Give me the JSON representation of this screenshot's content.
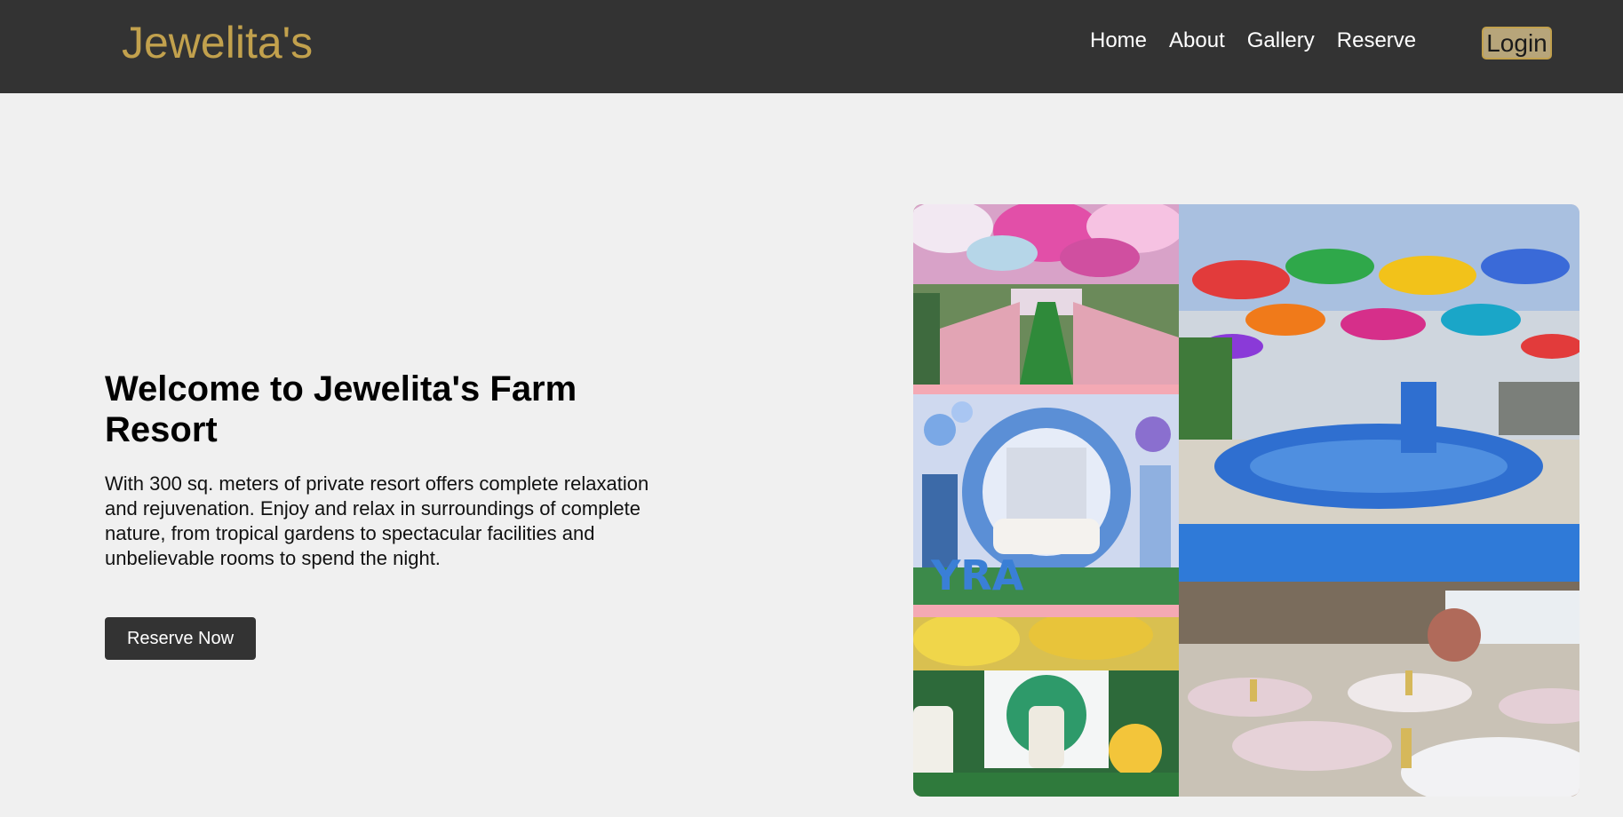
{
  "brand": {
    "name": "Jewelita's"
  },
  "nav": {
    "items": [
      {
        "label": "Home"
      },
      {
        "label": "About"
      },
      {
        "label": "Gallery"
      },
      {
        "label": "Reserve"
      }
    ],
    "login_label": "Login"
  },
  "hero": {
    "title": "Welcome to Jewelita's Farm Resort",
    "description": "With 300 sq. meters of private resort offers complete relaxation and rejuvenation. Enjoy and relax in surroundings of complete nature, from tropical gardens to spectacular facilities and unbelievable rooms to spend the night.",
    "cta_label": "Reserve Now"
  },
  "colors": {
    "nav_bg": "#333333",
    "brand": "#c2a14d",
    "page_bg": "#f0f0f0",
    "button_bg": "#333333"
  }
}
